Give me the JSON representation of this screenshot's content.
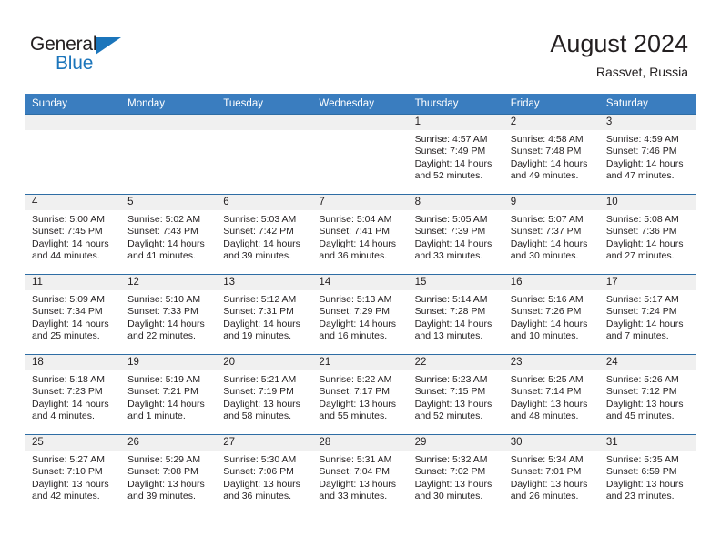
{
  "brand": {
    "name_top": "General",
    "name_bottom": "Blue",
    "triangle_icon": "triangle-icon",
    "color_primary": "#1b75bb",
    "color_dark": "#231f20"
  },
  "header": {
    "title": "August 2024",
    "subtitle": "Rassvet, Russia"
  },
  "theme": {
    "header_row_bg": "#3a7dbf",
    "daynum_bg": "#f0f0f0",
    "row_border": "#2e6da4",
    "cell_bg": "#ffffff"
  },
  "weekday_headers": [
    "Sunday",
    "Monday",
    "Tuesday",
    "Wednesday",
    "Thursday",
    "Friday",
    "Saturday"
  ],
  "weeks": [
    [
      {
        "day": "",
        "empty": true,
        "sunrise": "",
        "sunset": "",
        "daylight_1": "",
        "daylight_2": ""
      },
      {
        "day": "",
        "empty": true,
        "sunrise": "",
        "sunset": "",
        "daylight_1": "",
        "daylight_2": ""
      },
      {
        "day": "",
        "empty": true,
        "sunrise": "",
        "sunset": "",
        "daylight_1": "",
        "daylight_2": ""
      },
      {
        "day": "",
        "empty": true,
        "sunrise": "",
        "sunset": "",
        "daylight_1": "",
        "daylight_2": ""
      },
      {
        "day": "1",
        "empty": false,
        "sunrise": "Sunrise: 4:57 AM",
        "sunset": "Sunset: 7:49 PM",
        "daylight_1": "Daylight: 14 hours",
        "daylight_2": "and 52 minutes."
      },
      {
        "day": "2",
        "empty": false,
        "sunrise": "Sunrise: 4:58 AM",
        "sunset": "Sunset: 7:48 PM",
        "daylight_1": "Daylight: 14 hours",
        "daylight_2": "and 49 minutes."
      },
      {
        "day": "3",
        "empty": false,
        "sunrise": "Sunrise: 4:59 AM",
        "sunset": "Sunset: 7:46 PM",
        "daylight_1": "Daylight: 14 hours",
        "daylight_2": "and 47 minutes."
      }
    ],
    [
      {
        "day": "4",
        "empty": false,
        "sunrise": "Sunrise: 5:00 AM",
        "sunset": "Sunset: 7:45 PM",
        "daylight_1": "Daylight: 14 hours",
        "daylight_2": "and 44 minutes."
      },
      {
        "day": "5",
        "empty": false,
        "sunrise": "Sunrise: 5:02 AM",
        "sunset": "Sunset: 7:43 PM",
        "daylight_1": "Daylight: 14 hours",
        "daylight_2": "and 41 minutes."
      },
      {
        "day": "6",
        "empty": false,
        "sunrise": "Sunrise: 5:03 AM",
        "sunset": "Sunset: 7:42 PM",
        "daylight_1": "Daylight: 14 hours",
        "daylight_2": "and 39 minutes."
      },
      {
        "day": "7",
        "empty": false,
        "sunrise": "Sunrise: 5:04 AM",
        "sunset": "Sunset: 7:41 PM",
        "daylight_1": "Daylight: 14 hours",
        "daylight_2": "and 36 minutes."
      },
      {
        "day": "8",
        "empty": false,
        "sunrise": "Sunrise: 5:05 AM",
        "sunset": "Sunset: 7:39 PM",
        "daylight_1": "Daylight: 14 hours",
        "daylight_2": "and 33 minutes."
      },
      {
        "day": "9",
        "empty": false,
        "sunrise": "Sunrise: 5:07 AM",
        "sunset": "Sunset: 7:37 PM",
        "daylight_1": "Daylight: 14 hours",
        "daylight_2": "and 30 minutes."
      },
      {
        "day": "10",
        "empty": false,
        "sunrise": "Sunrise: 5:08 AM",
        "sunset": "Sunset: 7:36 PM",
        "daylight_1": "Daylight: 14 hours",
        "daylight_2": "and 27 minutes."
      }
    ],
    [
      {
        "day": "11",
        "empty": false,
        "sunrise": "Sunrise: 5:09 AM",
        "sunset": "Sunset: 7:34 PM",
        "daylight_1": "Daylight: 14 hours",
        "daylight_2": "and 25 minutes."
      },
      {
        "day": "12",
        "empty": false,
        "sunrise": "Sunrise: 5:10 AM",
        "sunset": "Sunset: 7:33 PM",
        "daylight_1": "Daylight: 14 hours",
        "daylight_2": "and 22 minutes."
      },
      {
        "day": "13",
        "empty": false,
        "sunrise": "Sunrise: 5:12 AM",
        "sunset": "Sunset: 7:31 PM",
        "daylight_1": "Daylight: 14 hours",
        "daylight_2": "and 19 minutes."
      },
      {
        "day": "14",
        "empty": false,
        "sunrise": "Sunrise: 5:13 AM",
        "sunset": "Sunset: 7:29 PM",
        "daylight_1": "Daylight: 14 hours",
        "daylight_2": "and 16 minutes."
      },
      {
        "day": "15",
        "empty": false,
        "sunrise": "Sunrise: 5:14 AM",
        "sunset": "Sunset: 7:28 PM",
        "daylight_1": "Daylight: 14 hours",
        "daylight_2": "and 13 minutes."
      },
      {
        "day": "16",
        "empty": false,
        "sunrise": "Sunrise: 5:16 AM",
        "sunset": "Sunset: 7:26 PM",
        "daylight_1": "Daylight: 14 hours",
        "daylight_2": "and 10 minutes."
      },
      {
        "day": "17",
        "empty": false,
        "sunrise": "Sunrise: 5:17 AM",
        "sunset": "Sunset: 7:24 PM",
        "daylight_1": "Daylight: 14 hours",
        "daylight_2": "and 7 minutes."
      }
    ],
    [
      {
        "day": "18",
        "empty": false,
        "sunrise": "Sunrise: 5:18 AM",
        "sunset": "Sunset: 7:23 PM",
        "daylight_1": "Daylight: 14 hours",
        "daylight_2": "and 4 minutes."
      },
      {
        "day": "19",
        "empty": false,
        "sunrise": "Sunrise: 5:19 AM",
        "sunset": "Sunset: 7:21 PM",
        "daylight_1": "Daylight: 14 hours",
        "daylight_2": "and 1 minute."
      },
      {
        "day": "20",
        "empty": false,
        "sunrise": "Sunrise: 5:21 AM",
        "sunset": "Sunset: 7:19 PM",
        "daylight_1": "Daylight: 13 hours",
        "daylight_2": "and 58 minutes."
      },
      {
        "day": "21",
        "empty": false,
        "sunrise": "Sunrise: 5:22 AM",
        "sunset": "Sunset: 7:17 PM",
        "daylight_1": "Daylight: 13 hours",
        "daylight_2": "and 55 minutes."
      },
      {
        "day": "22",
        "empty": false,
        "sunrise": "Sunrise: 5:23 AM",
        "sunset": "Sunset: 7:15 PM",
        "daylight_1": "Daylight: 13 hours",
        "daylight_2": "and 52 minutes."
      },
      {
        "day": "23",
        "empty": false,
        "sunrise": "Sunrise: 5:25 AM",
        "sunset": "Sunset: 7:14 PM",
        "daylight_1": "Daylight: 13 hours",
        "daylight_2": "and 48 minutes."
      },
      {
        "day": "24",
        "empty": false,
        "sunrise": "Sunrise: 5:26 AM",
        "sunset": "Sunset: 7:12 PM",
        "daylight_1": "Daylight: 13 hours",
        "daylight_2": "and 45 minutes."
      }
    ],
    [
      {
        "day": "25",
        "empty": false,
        "sunrise": "Sunrise: 5:27 AM",
        "sunset": "Sunset: 7:10 PM",
        "daylight_1": "Daylight: 13 hours",
        "daylight_2": "and 42 minutes."
      },
      {
        "day": "26",
        "empty": false,
        "sunrise": "Sunrise: 5:29 AM",
        "sunset": "Sunset: 7:08 PM",
        "daylight_1": "Daylight: 13 hours",
        "daylight_2": "and 39 minutes."
      },
      {
        "day": "27",
        "empty": false,
        "sunrise": "Sunrise: 5:30 AM",
        "sunset": "Sunset: 7:06 PM",
        "daylight_1": "Daylight: 13 hours",
        "daylight_2": "and 36 minutes."
      },
      {
        "day": "28",
        "empty": false,
        "sunrise": "Sunrise: 5:31 AM",
        "sunset": "Sunset: 7:04 PM",
        "daylight_1": "Daylight: 13 hours",
        "daylight_2": "and 33 minutes."
      },
      {
        "day": "29",
        "empty": false,
        "sunrise": "Sunrise: 5:32 AM",
        "sunset": "Sunset: 7:02 PM",
        "daylight_1": "Daylight: 13 hours",
        "daylight_2": "and 30 minutes."
      },
      {
        "day": "30",
        "empty": false,
        "sunrise": "Sunrise: 5:34 AM",
        "sunset": "Sunset: 7:01 PM",
        "daylight_1": "Daylight: 13 hours",
        "daylight_2": "and 26 minutes."
      },
      {
        "day": "31",
        "empty": false,
        "sunrise": "Sunrise: 5:35 AM",
        "sunset": "Sunset: 6:59 PM",
        "daylight_1": "Daylight: 13 hours",
        "daylight_2": "and 23 minutes."
      }
    ]
  ]
}
